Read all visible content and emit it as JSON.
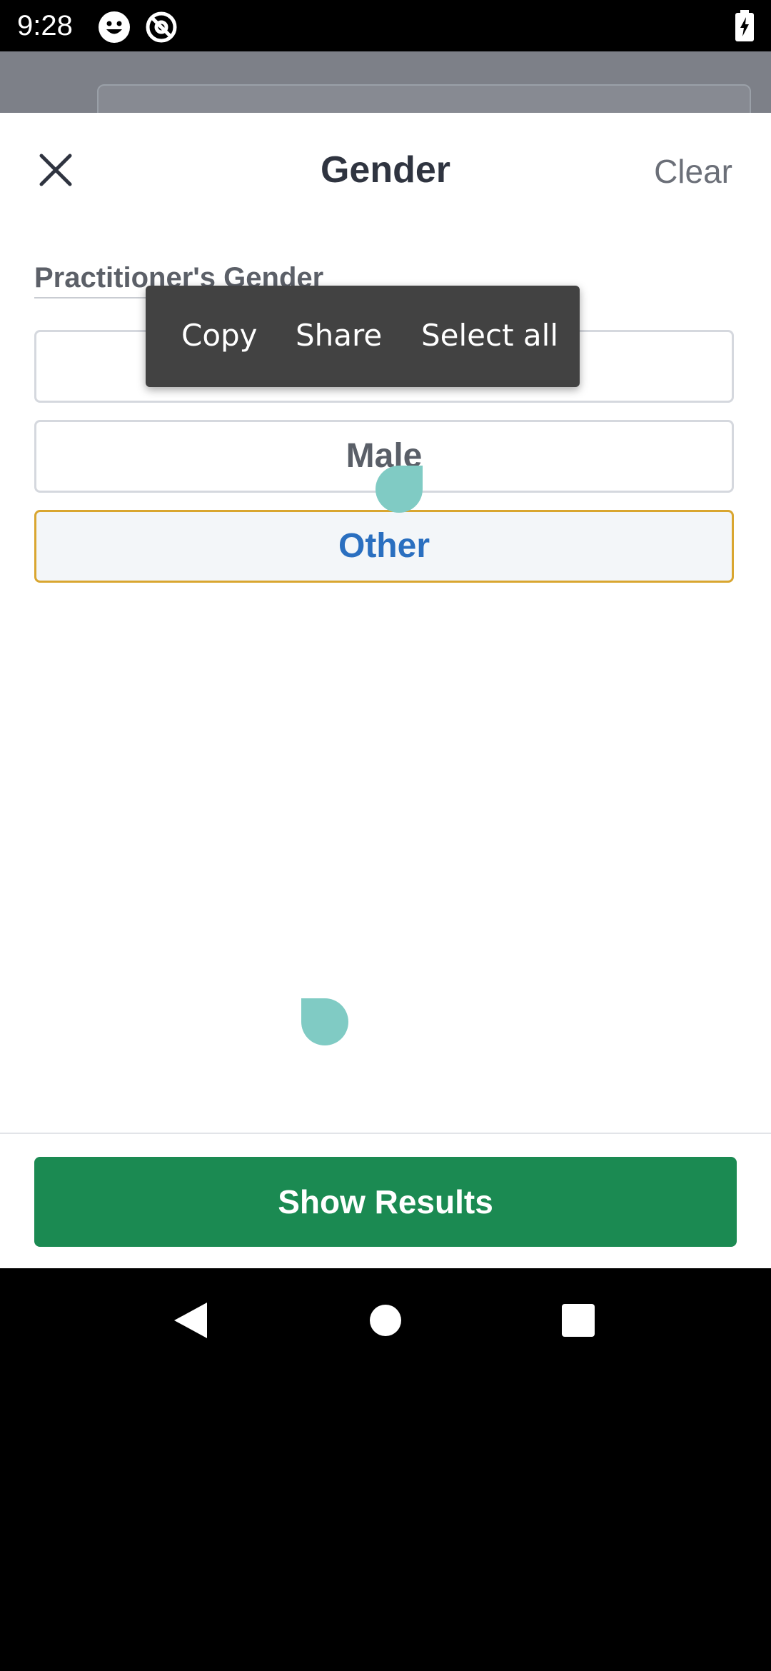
{
  "status_bar": {
    "time": "9:28",
    "icons": [
      "emoji-icon",
      "at-sign-icon",
      "battery-charging-icon"
    ]
  },
  "sheet": {
    "title": "Gender",
    "clear_label": "Clear",
    "section_label": "Practitioner's Gender",
    "options": [
      {
        "label": "",
        "selected": false
      },
      {
        "label": "Male",
        "selected": false
      },
      {
        "label": "Other",
        "selected": true
      }
    ],
    "show_results_label": "Show Results"
  },
  "context_menu": {
    "items": [
      "Copy",
      "Share",
      "Select all"
    ]
  },
  "nav_bar": {
    "icons": [
      "back-icon",
      "home-icon",
      "recents-icon"
    ]
  },
  "colors": {
    "primary_green": "#1b8a52",
    "selected_border": "#d9a630",
    "selected_text": "#2a6fc0",
    "handle": "#80cbc4"
  }
}
